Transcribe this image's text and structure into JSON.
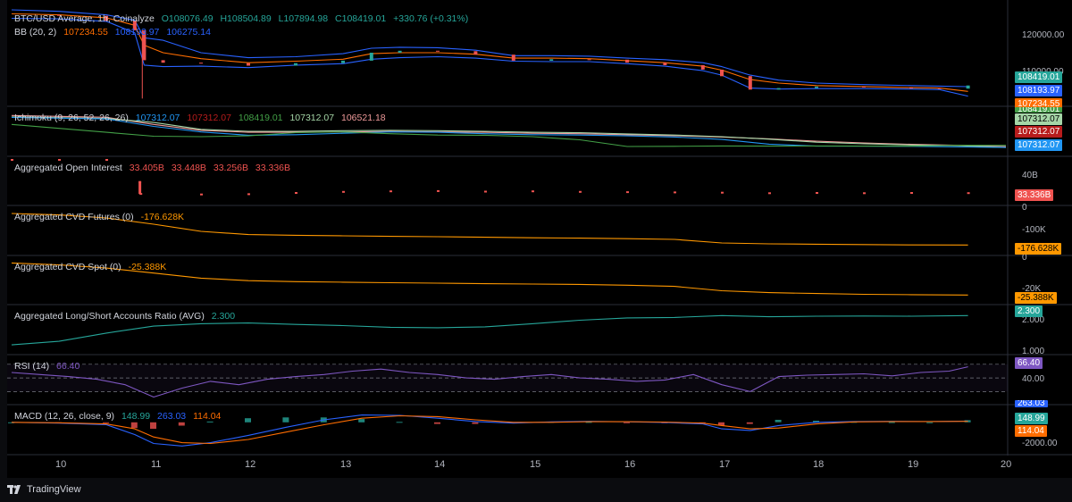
{
  "chart_data": [
    {
      "type": "line",
      "id": "price",
      "title": "BTC/USD Average, 1h, Coinalyze",
      "ohlc": {
        "O": "O108076.49",
        "H": "H108504.89",
        "L": "L107894.98",
        "C": "C108419.01",
        "change": "+330.76 (+0.31%)"
      },
      "bb_legend": {
        "name": "BB (20, 2)",
        "v1": "107234.55",
        "v2": "108193.97",
        "v3": "106275.14"
      },
      "x_ticks": [
        "10",
        "11",
        "12",
        "13",
        "14",
        "15",
        "16",
        "17",
        "18",
        "19",
        "20"
      ],
      "y_ticks": [
        "120000.00",
        "110000.00"
      ],
      "last_values": {
        "close": "108419.01",
        "upper": "108193.97",
        "basis": "107234.55",
        "close2": "108419.01"
      },
      "x": [
        9.5,
        10.0,
        10.5,
        10.8,
        10.9,
        11.1,
        11.5,
        12.0,
        12.5,
        13.0,
        13.3,
        13.6,
        14.0,
        14.4,
        14.8,
        15.2,
        15.6,
        16.0,
        16.4,
        16.8,
        17.0,
        17.3,
        17.6,
        18.0,
        18.5,
        19.0,
        19.3,
        19.6
      ],
      "close": [
        122600,
        122400,
        121400,
        119500,
        113500,
        113000,
        112900,
        112400,
        112900,
        113400,
        115000,
        115400,
        115300,
        114600,
        113400,
        113700,
        113600,
        113000,
        112500,
        111600,
        110300,
        107600,
        107900,
        108200,
        108000,
        107900,
        107800,
        108420
      ],
      "bb_upper": [
        123600,
        123300,
        122600,
        121500,
        118000,
        117500,
        115000,
        114000,
        114200,
        114800,
        115900,
        116100,
        116000,
        115500,
        114400,
        114400,
        114300,
        113900,
        113600,
        113000,
        112200,
        110500,
        109500,
        108900,
        108600,
        108400,
        108300,
        108190
      ],
      "bb_basis": [
        122800,
        122600,
        122000,
        120500,
        116500,
        115000,
        113800,
        113000,
        113300,
        113700,
        114800,
        115000,
        115000,
        114700,
        113900,
        113900,
        113800,
        113400,
        113000,
        112300,
        111500,
        109600,
        108900,
        108400,
        108200,
        108000,
        107900,
        107230
      ],
      "bb_lower": [
        121900,
        121800,
        121300,
        119000,
        112500,
        112200,
        112300,
        112000,
        112500,
        112800,
        113700,
        114000,
        114200,
        113900,
        113300,
        113200,
        113200,
        112800,
        112300,
        111400,
        110500,
        107900,
        107700,
        107800,
        107800,
        107700,
        107600,
        106280
      ],
      "ylim": [
        105500,
        124500
      ]
    },
    {
      "type": "line",
      "id": "ichimoku",
      "legend": {
        "name": "Ichimoku (9, 26, 52, 26, 26)",
        "v1": "107312.07",
        "v2": "107312.07",
        "v3": "108419.01",
        "v4": "107312.07",
        "v5": "106521.18"
      },
      "last_values": {
        "lagging": "108419.01",
        "conversion": "107312.07",
        "base": "107312.07",
        "spanA": "107312.07"
      },
      "x": [
        9.5,
        10.5,
        11.0,
        11.5,
        12.0,
        12.5,
        13.0,
        13.5,
        14.0,
        14.5,
        15.0,
        15.5,
        16.0,
        16.5,
        17.0,
        17.5,
        18.0,
        18.5,
        19.0,
        19.5,
        20.0
      ],
      "span_a": [
        122800,
        122000,
        120000,
        116500,
        115500,
        115500,
        115800,
        116000,
        115800,
        115500,
        115000,
        114800,
        114200,
        113600,
        112800,
        111500,
        110000,
        109200,
        108600,
        108200,
        107312
      ],
      "span_b": [
        123500,
        122600,
        119000,
        116000,
        115000,
        115000,
        115200,
        115400,
        115200,
        115000,
        114500,
        114300,
        113800,
        113300,
        112600,
        111700,
        110500,
        109600,
        108900,
        108400,
        107800
      ],
      "lagging": [
        119000,
        115000,
        113000,
        112800,
        113200,
        114800,
        115200,
        114300,
        113600,
        113500,
        112800,
        111200,
        107800,
        107900,
        108100,
        108000,
        108100,
        108000,
        108000,
        108400,
        108419
      ],
      "conversion": [
        122500,
        121800,
        118000,
        115200,
        113500,
        113800,
        114500,
        115200,
        115000,
        114300,
        113800,
        113600,
        113200,
        112600,
        111400,
        109000,
        108000,
        108000,
        107900,
        107600,
        107312
      ],
      "ylim": [
        106000,
        125000
      ]
    },
    {
      "type": "bar",
      "id": "open_interest",
      "legend": {
        "name": "Aggregated Open Interest",
        "open": "33.405B",
        "high": "33.448B",
        "low": "33.256B",
        "close": "33.336B"
      },
      "y_ticks": [
        "40B"
      ],
      "last_value": "33.336B",
      "x": [
        9.5,
        10.0,
        10.5,
        10.85,
        10.86,
        11.5,
        12.0,
        12.5,
        13.0,
        13.5,
        14.0,
        14.5,
        15.0,
        15.5,
        16.0,
        16.5,
        17.0,
        17.5,
        18.0,
        18.5,
        19.0,
        19.6
      ],
      "values": [
        55,
        55,
        55,
        37.6,
        33.0,
        32.8,
        32.9,
        33.4,
        33.8,
        34.0,
        34.1,
        33.9,
        34.0,
        33.8,
        33.7,
        33.6,
        33.5,
        33.3,
        33.4,
        33.3,
        33.4,
        33.336
      ],
      "ylim": [
        31,
        45
      ]
    },
    {
      "type": "line",
      "id": "cvd_futures",
      "legend": {
        "name": "Aggregated CVD Futures (0)",
        "value": "-176.628K"
      },
      "y_ticks": [
        "0",
        "-100K"
      ],
      "last_value": "-176.628K",
      "x": [
        9.5,
        10.0,
        10.5,
        11.0,
        11.5,
        12.0,
        12.5,
        13.0,
        13.5,
        14.0,
        14.5,
        15.0,
        15.5,
        16.0,
        16.5,
        17.0,
        17.5,
        18.0,
        18.5,
        19.0,
        19.6
      ],
      "values": [
        0,
        -8000,
        -25000,
        -60000,
        -100000,
        -118000,
        -122000,
        -125000,
        -128000,
        -130000,
        -133000,
        -136000,
        -138000,
        -141000,
        -145000,
        -165000,
        -170000,
        -172000,
        -174000,
        -176000,
        -176628
      ],
      "ylim": [
        -200000,
        10000
      ]
    },
    {
      "type": "line",
      "id": "cvd_spot",
      "legend": {
        "name": "Aggregated CVD Spot (0)",
        "value": "-25.388K"
      },
      "y_ticks": [
        "0",
        "-20K"
      ],
      "last_value": "-25.388K",
      "x": [
        9.5,
        10.0,
        10.5,
        11.0,
        11.5,
        12.0,
        12.5,
        13.0,
        13.5,
        14.0,
        14.5,
        15.0,
        15.5,
        16.0,
        16.5,
        17.0,
        17.5,
        18.0,
        18.5,
        19.0,
        19.6
      ],
      "values": [
        0,
        -1500,
        -4000,
        -8000,
        -12000,
        -14000,
        -14800,
        -15200,
        -15600,
        -16000,
        -16400,
        -16700,
        -17000,
        -17600,
        -18500,
        -22000,
        -23500,
        -24200,
        -24800,
        -25100,
        -25388
      ],
      "ylim": [
        -28000,
        1000
      ]
    },
    {
      "type": "line",
      "id": "long_short_ratio",
      "legend": {
        "name": "Aggregated Long/Short Accounts Ratio (AVG)",
        "value": "2.300"
      },
      "y_ticks": [
        "2.000",
        "1.000"
      ],
      "last_value": "2.300",
      "x": [
        9.5,
        10.0,
        10.5,
        11.0,
        11.5,
        12.0,
        12.5,
        13.0,
        13.5,
        14.0,
        14.5,
        15.0,
        15.5,
        16.0,
        16.5,
        17.0,
        17.5,
        18.0,
        18.5,
        19.0,
        19.6
      ],
      "values": [
        1.05,
        1.2,
        1.55,
        1.85,
        1.95,
        1.98,
        1.92,
        1.87,
        1.8,
        1.78,
        1.82,
        1.95,
        2.1,
        2.2,
        2.22,
        2.3,
        2.25,
        2.27,
        2.28,
        2.27,
        2.3
      ],
      "ylim": [
        0.9,
        2.5
      ]
    },
    {
      "type": "line",
      "id": "rsi",
      "legend": {
        "name": "RSI (14)",
        "value": "66.40"
      },
      "y_ticks": [
        "40.00"
      ],
      "last_value": "66.40",
      "x": [
        9.5,
        9.8,
        10.1,
        10.4,
        10.7,
        11.0,
        11.3,
        11.6,
        11.9,
        12.2,
        12.5,
        12.8,
        13.1,
        13.4,
        13.7,
        14.0,
        14.3,
        14.6,
        14.9,
        15.2,
        15.5,
        15.8,
        16.1,
        16.4,
        16.7,
        17.0,
        17.3,
        17.6,
        17.9,
        18.2,
        18.5,
        18.8,
        19.1,
        19.4,
        19.6
      ],
      "values": [
        58,
        55,
        52,
        48,
        40,
        22,
        35,
        45,
        40,
        48,
        52,
        55,
        60,
        63,
        58,
        55,
        50,
        48,
        52,
        55,
        50,
        48,
        45,
        47,
        55,
        40,
        30,
        52,
        54,
        55,
        56,
        53,
        58,
        60,
        66.4
      ],
      "ylim": [
        20,
        75
      ]
    },
    {
      "type": "bar",
      "id": "macd",
      "legend": {
        "name": "MACD (12, 26, close, 9)",
        "v1": "148.99",
        "v2": "263.03",
        "v3": "114.04"
      },
      "y_ticks": [
        "-2000.00"
      ],
      "last_values": {
        "hist": "263.03",
        "macd": "148.99",
        "signal": "114.04"
      },
      "x": [
        9.5,
        10.0,
        10.5,
        10.8,
        11.0,
        11.3,
        11.6,
        12.0,
        12.4,
        12.8,
        13.2,
        13.6,
        14.0,
        14.4,
        14.8,
        15.2,
        15.6,
        16.0,
        16.4,
        16.8,
        17.0,
        17.3,
        17.6,
        18.0,
        18.4,
        18.8,
        19.2,
        19.6
      ],
      "macd_line": [
        0,
        -100,
        -300,
        -1500,
        -2600,
        -2900,
        -2500,
        -1600,
        -600,
        300,
        900,
        850,
        500,
        100,
        -100,
        50,
        120,
        60,
        -20,
        -200,
        -800,
        -1000,
        -400,
        0,
        100,
        120,
        100,
        149
      ],
      "signal_line": [
        0,
        -60,
        -200,
        -800,
        -1800,
        -2500,
        -2600,
        -2100,
        -1200,
        -300,
        500,
        800,
        700,
        300,
        0,
        0,
        80,
        80,
        30,
        -100,
        -400,
        -800,
        -700,
        -200,
        50,
        100,
        100,
        114
      ],
      "histogram": [
        0,
        -40,
        -100,
        -700,
        -800,
        -400,
        100,
        500,
        600,
        600,
        400,
        50,
        -200,
        -200,
        -100,
        50,
        40,
        -20,
        -50,
        -100,
        -400,
        -200,
        300,
        200,
        50,
        20,
        0,
        263
      ],
      "ylim": [
        -3200,
        1400
      ]
    }
  ],
  "branding": {
    "logo_text": "TradingView"
  },
  "colors": {
    "up": "#26a69a",
    "down": "#ef5350",
    "bb_upper": "#2962ff",
    "bb_basis": "#ff6d00",
    "ichimoku_lagging": "#43a047",
    "ichimoku_conv": "#2196f3",
    "ichimoku_base": "#b71c1c",
    "oi": "#ef5350",
    "cvd": "#ff9800",
    "ls": "#26a69a",
    "rsi": "#7e57c2",
    "macd": "#2962ff",
    "signal": "#ff6d00"
  }
}
